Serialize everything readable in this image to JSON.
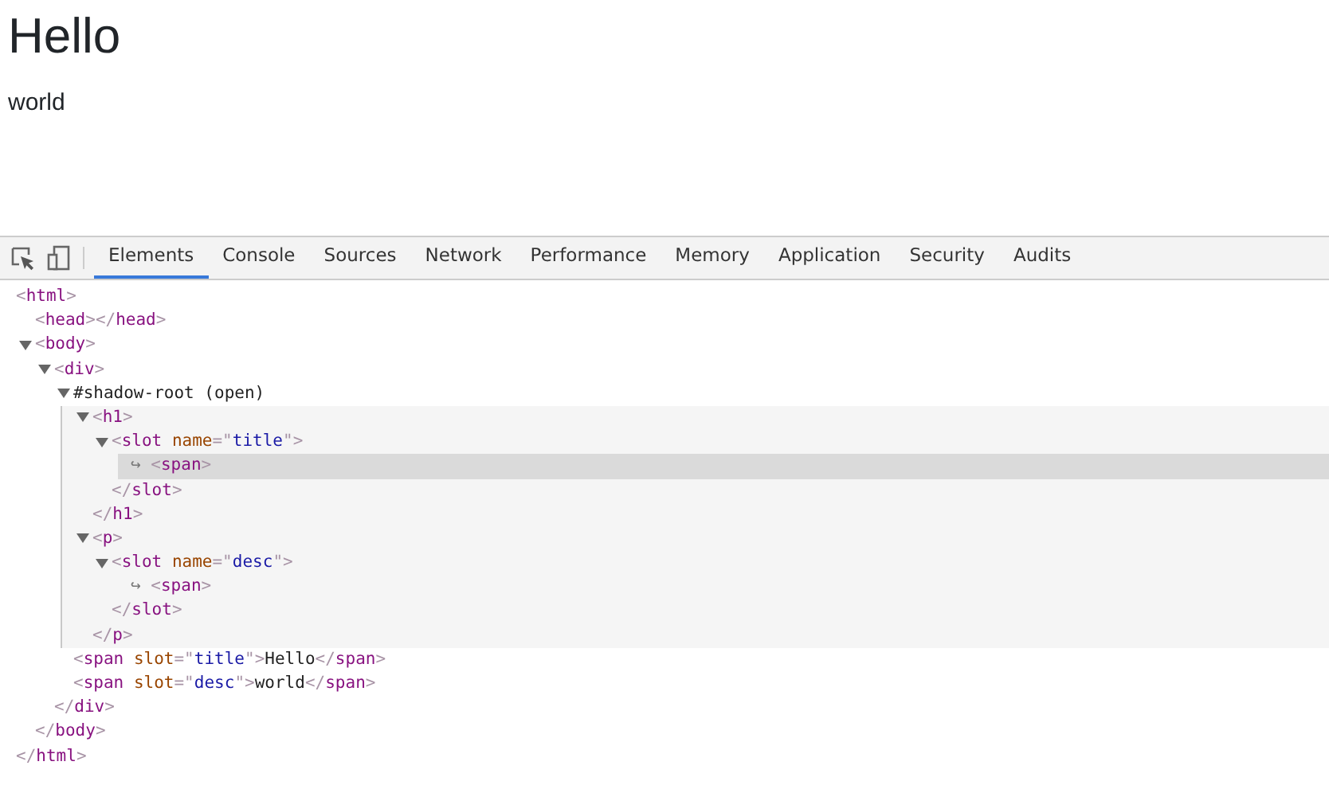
{
  "page": {
    "heading": "Hello",
    "paragraph": "world"
  },
  "devtools": {
    "tabs": [
      {
        "label": "Elements",
        "selected": true
      },
      {
        "label": "Console",
        "selected": false
      },
      {
        "label": "Sources",
        "selected": false
      },
      {
        "label": "Network",
        "selected": false
      },
      {
        "label": "Performance",
        "selected": false
      },
      {
        "label": "Memory",
        "selected": false
      },
      {
        "label": "Application",
        "selected": false
      },
      {
        "label": "Security",
        "selected": false
      },
      {
        "label": "Audits",
        "selected": false
      }
    ],
    "dom_tree": [
      {
        "kind": "element",
        "parts": [
          {
            "kind": "punct",
            "text": "<"
          },
          {
            "kind": "tag",
            "text": "html"
          },
          {
            "kind": "punct",
            "text": ">"
          }
        ],
        "closing": [
          {
            "kind": "punct",
            "text": "</"
          },
          {
            "kind": "tag",
            "text": "html"
          },
          {
            "kind": "punct",
            "text": ">"
          }
        ],
        "children": [
          {
            "kind": "element",
            "parts": [
              {
                "kind": "punct",
                "text": "<"
              },
              {
                "kind": "tag",
                "text": "head"
              },
              {
                "kind": "punct",
                "text": "></"
              },
              {
                "kind": "tag",
                "text": "head"
              },
              {
                "kind": "punct",
                "text": ">"
              }
            ]
          },
          {
            "kind": "element",
            "expanded": true,
            "parts": [
              {
                "kind": "punct",
                "text": "<"
              },
              {
                "kind": "tag",
                "text": "body"
              },
              {
                "kind": "punct",
                "text": ">"
              }
            ],
            "closing": [
              {
                "kind": "punct",
                "text": "</"
              },
              {
                "kind": "tag",
                "text": "body"
              },
              {
                "kind": "punct",
                "text": ">"
              }
            ],
            "children": [
              {
                "kind": "element",
                "expanded": true,
                "parts": [
                  {
                    "kind": "punct",
                    "text": "<"
                  },
                  {
                    "kind": "tag",
                    "text": "div"
                  },
                  {
                    "kind": "punct",
                    "text": ">"
                  }
                ],
                "closing": [
                  {
                    "kind": "punct",
                    "text": "</"
                  },
                  {
                    "kind": "tag",
                    "text": "div"
                  },
                  {
                    "kind": "punct",
                    "text": ">"
                  }
                ],
                "children": [
                  {
                    "kind": "shadow",
                    "expanded": true,
                    "parts": [
                      {
                        "kind": "text",
                        "text": "#shadow-root (open)"
                      }
                    ],
                    "children": [
                      {
                        "kind": "element",
                        "expanded": true,
                        "parts": [
                          {
                            "kind": "punct",
                            "text": "<"
                          },
                          {
                            "kind": "tag",
                            "text": "h1"
                          },
                          {
                            "kind": "punct",
                            "text": ">"
                          }
                        ],
                        "closing": [
                          {
                            "kind": "punct",
                            "text": "</"
                          },
                          {
                            "kind": "tag",
                            "text": "h1"
                          },
                          {
                            "kind": "punct",
                            "text": ">"
                          }
                        ],
                        "children": [
                          {
                            "kind": "element",
                            "expanded": true,
                            "parts": [
                              {
                                "kind": "punct",
                                "text": "<"
                              },
                              {
                                "kind": "tag",
                                "text": "slot"
                              },
                              {
                                "kind": "attr",
                                "text": " name"
                              },
                              {
                                "kind": "punct",
                                "text": "=\""
                              },
                              {
                                "kind": "value",
                                "text": "title"
                              },
                              {
                                "kind": "punct",
                                "text": "\">"
                              }
                            ],
                            "closing": [
                              {
                                "kind": "punct",
                                "text": "</"
                              },
                              {
                                "kind": "tag",
                                "text": "slot"
                              },
                              {
                                "kind": "punct",
                                "text": ">"
                              }
                            ],
                            "children": [
                              {
                                "kind": "reference",
                                "selected": true,
                                "parts": [
                                  {
                                    "kind": "arrow",
                                    "text": "↪ "
                                  },
                                  {
                                    "kind": "punct",
                                    "text": "<"
                                  },
                                  {
                                    "kind": "tag",
                                    "text": "span"
                                  },
                                  {
                                    "kind": "punct",
                                    "text": ">"
                                  }
                                ]
                              }
                            ]
                          }
                        ]
                      },
                      {
                        "kind": "element",
                        "expanded": true,
                        "parts": [
                          {
                            "kind": "punct",
                            "text": "<"
                          },
                          {
                            "kind": "tag",
                            "text": "p"
                          },
                          {
                            "kind": "punct",
                            "text": ">"
                          }
                        ],
                        "closing": [
                          {
                            "kind": "punct",
                            "text": "</"
                          },
                          {
                            "kind": "tag",
                            "text": "p"
                          },
                          {
                            "kind": "punct",
                            "text": ">"
                          }
                        ],
                        "children": [
                          {
                            "kind": "element",
                            "expanded": true,
                            "parts": [
                              {
                                "kind": "punct",
                                "text": "<"
                              },
                              {
                                "kind": "tag",
                                "text": "slot"
                              },
                              {
                                "kind": "attr",
                                "text": " name"
                              },
                              {
                                "kind": "punct",
                                "text": "=\""
                              },
                              {
                                "kind": "value",
                                "text": "desc"
                              },
                              {
                                "kind": "punct",
                                "text": "\">"
                              }
                            ],
                            "closing": [
                              {
                                "kind": "punct",
                                "text": "</"
                              },
                              {
                                "kind": "tag",
                                "text": "slot"
                              },
                              {
                                "kind": "punct",
                                "text": ">"
                              }
                            ],
                            "children": [
                              {
                                "kind": "reference",
                                "selected": false,
                                "parts": [
                                  {
                                    "kind": "arrow",
                                    "text": "↪ "
                                  },
                                  {
                                    "kind": "punct",
                                    "text": "<"
                                  },
                                  {
                                    "kind": "tag",
                                    "text": "span"
                                  },
                                  {
                                    "kind": "punct",
                                    "text": ">"
                                  }
                                ]
                              }
                            ]
                          }
                        ]
                      }
                    ]
                  },
                  {
                    "kind": "element",
                    "parts": [
                      {
                        "kind": "punct",
                        "text": "<"
                      },
                      {
                        "kind": "tag",
                        "text": "span"
                      },
                      {
                        "kind": "attr",
                        "text": " slot"
                      },
                      {
                        "kind": "punct",
                        "text": "=\""
                      },
                      {
                        "kind": "value",
                        "text": "title"
                      },
                      {
                        "kind": "punct",
                        "text": "\">"
                      },
                      {
                        "kind": "text",
                        "text": "Hello"
                      },
                      {
                        "kind": "punct",
                        "text": "</"
                      },
                      {
                        "kind": "tag",
                        "text": "span"
                      },
                      {
                        "kind": "punct",
                        "text": ">"
                      }
                    ]
                  },
                  {
                    "kind": "element",
                    "parts": [
                      {
                        "kind": "punct",
                        "text": "<"
                      },
                      {
                        "kind": "tag",
                        "text": "span"
                      },
                      {
                        "kind": "attr",
                        "text": " slot"
                      },
                      {
                        "kind": "punct",
                        "text": "=\""
                      },
                      {
                        "kind": "value",
                        "text": "desc"
                      },
                      {
                        "kind": "punct",
                        "text": "\">"
                      },
                      {
                        "kind": "text",
                        "text": "world"
                      },
                      {
                        "kind": "punct",
                        "text": "</"
                      },
                      {
                        "kind": "tag",
                        "text": "span"
                      },
                      {
                        "kind": "punct",
                        "text": ">"
                      }
                    ]
                  }
                ]
              }
            ]
          }
        ]
      }
    ]
  }
}
